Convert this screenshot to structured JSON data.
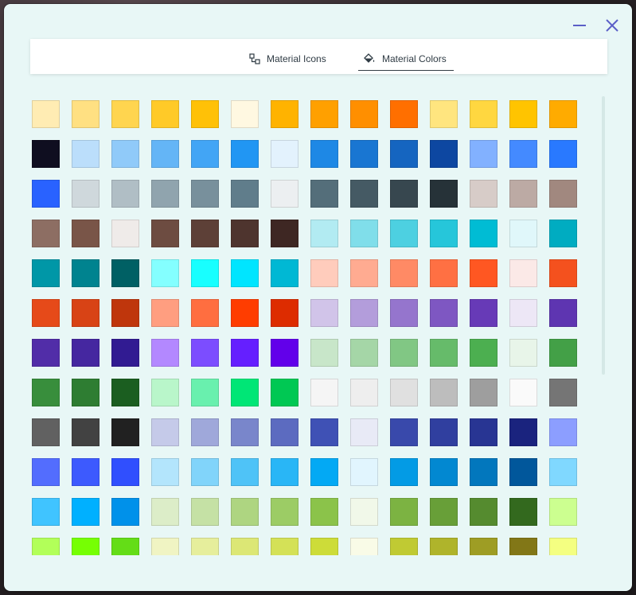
{
  "window": {
    "accent": "#5b5fc7",
    "background": "#e8f7f6"
  },
  "tabs": [
    {
      "label": "Material Icons",
      "icon": "icon-set-icon",
      "selected": false
    },
    {
      "label": "Material Colors",
      "icon": "paint-bucket-icon",
      "selected": true
    }
  ],
  "colors": [
    "#FFECB3",
    "#FFE082",
    "#FFD54F",
    "#FFCA28",
    "#FFC107",
    "#FFF8E1",
    "#FFB300",
    "#FFA000",
    "#FF8F00",
    "#FF6F00",
    "#FFE57F",
    "#FFD740",
    "#FFC400",
    "#FFAB00",
    "#0F0E20",
    "#BBDEFB",
    "#90CAF9",
    "#64B5F6",
    "#42A5F5",
    "#2196F3",
    "#E3F2FD",
    "#1E88E5",
    "#1976D2",
    "#1565C0",
    "#0D47A1",
    "#82B1FF",
    "#448AFF",
    "#2979FF",
    "#2962FF",
    "#CFD8DC",
    "#B0BEC5",
    "#90A4AE",
    "#78909C",
    "#607D8B",
    "#ECEFF1",
    "#546E7A",
    "#455A64",
    "#37474F",
    "#263238",
    "#D7CCC8",
    "#BCAAA4",
    "#A1887F",
    "#8D6E63",
    "#795548",
    "#EFEBE9",
    "#6D4C41",
    "#5D4037",
    "#4E342E",
    "#3E2723",
    "#B2EBF2",
    "#80DEEA",
    "#4DD0E1",
    "#26C6DA",
    "#00BCD4",
    "#E0F7FA",
    "#00ACC1",
    "#0097A7",
    "#00838F",
    "#006064",
    "#84FFFF",
    "#18FFFF",
    "#00E5FF",
    "#00B8D4",
    "#FFCCBC",
    "#FFAB91",
    "#FF8A65",
    "#FF7043",
    "#FF5722",
    "#FBE9E7",
    "#F4511E",
    "#E64A19",
    "#D84315",
    "#BF360C",
    "#FF9E80",
    "#FF6E40",
    "#FF3D00",
    "#DD2C00",
    "#D1C4E9",
    "#B39DDB",
    "#9575CD",
    "#7E57C2",
    "#673AB7",
    "#EDE7F6",
    "#5E35B1",
    "#512DA8",
    "#4527A0",
    "#311B92",
    "#B388FF",
    "#7C4DFF",
    "#651FFF",
    "#6200EA",
    "#C8E6C9",
    "#A5D6A7",
    "#81C784",
    "#66BB6A",
    "#4CAF50",
    "#E8F5E9",
    "#43A047",
    "#388E3C",
    "#2E7D32",
    "#1B5E20",
    "#B9F6CA",
    "#69F0AE",
    "#00E676",
    "#00C853",
    "#F5F5F5",
    "#EEEEEE",
    "#E0E0E0",
    "#BDBDBD",
    "#9E9E9E",
    "#FAFAFA",
    "#757575",
    "#616161",
    "#424242",
    "#212121",
    "#C5CAE9",
    "#9FA8DA",
    "#7986CB",
    "#5C6BC0",
    "#3F51B5",
    "#E8EAF6",
    "#3949AB",
    "#303F9F",
    "#283593",
    "#1A237E",
    "#8C9EFF",
    "#536DFE",
    "#3D5AFE",
    "#304FFE",
    "#B3E5FC",
    "#81D4FA",
    "#4FC3F7",
    "#29B6F6",
    "#03A9F4",
    "#E1F5FE",
    "#039BE5",
    "#0288D1",
    "#0277BD",
    "#01579B",
    "#80D8FF",
    "#40C4FF",
    "#00B0FF",
    "#0091EA",
    "#DCEDC8",
    "#C5E1A5",
    "#AED581",
    "#9CCC65",
    "#8BC34A",
    "#F1F8E9",
    "#7CB342",
    "#689F38",
    "#558B2F",
    "#33691E",
    "#CCFF90",
    "#B2FF59",
    "#76FF03",
    "#64DD17",
    "#F0F4C3",
    "#E6EE9C",
    "#DCE775",
    "#D4E157",
    "#CDDC39",
    "#F9FBE7",
    "#C0CA33",
    "#AFB42B",
    "#9E9D24",
    "#827717",
    "#F4FF81"
  ]
}
